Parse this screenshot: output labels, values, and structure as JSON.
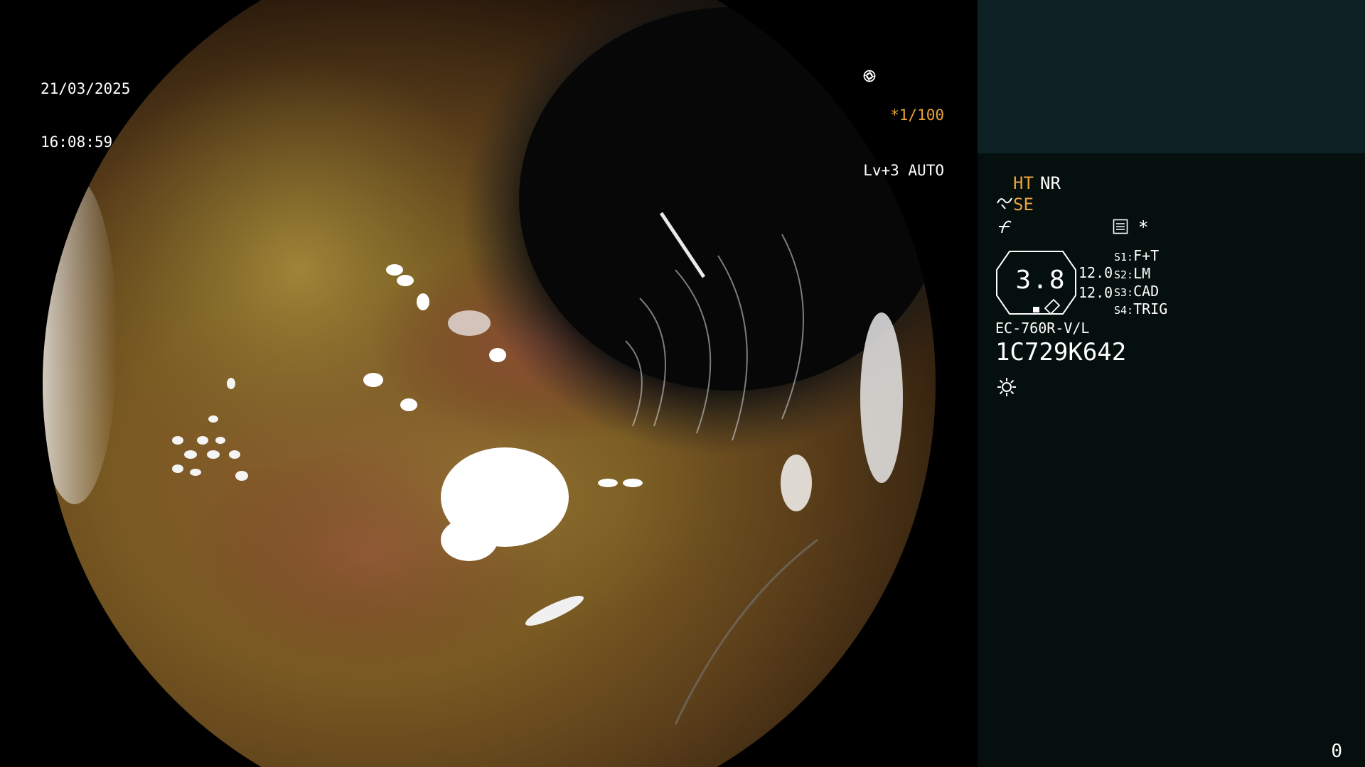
{
  "overlay": {
    "date": "21/03/2025",
    "time": "16:08:59",
    "shutter": "*1/100",
    "brightness": "Lv+3 AUTO"
  },
  "panel": {
    "mode_ht": "HT",
    "mode_nr": "NR",
    "mode_se": "SE",
    "star": "*",
    "zoom_value": "3.8",
    "numbers": [
      "12.0",
      "12.0"
    ],
    "switches": [
      {
        "key": "S1:",
        "value": "F+T"
      },
      {
        "key": "S2:",
        "value": "LM"
      },
      {
        "key": "S3:",
        "value": "CAD"
      },
      {
        "key": "S4:",
        "value": "TRIG"
      }
    ],
    "scope_model": "EC-760R-V/L",
    "serial": "1C729K642",
    "counter": "0"
  },
  "icons": {
    "shutter": "aperture-icon",
    "brightness": "iris-icon",
    "se": "enhance-wave-icon",
    "f": "f-hook-icon",
    "memo": "memo-icon",
    "light": "sun-icon"
  },
  "colors": {
    "accent": "#e9a23b",
    "panel_top": "#0c2123",
    "panel_bg": "#050f0d"
  }
}
